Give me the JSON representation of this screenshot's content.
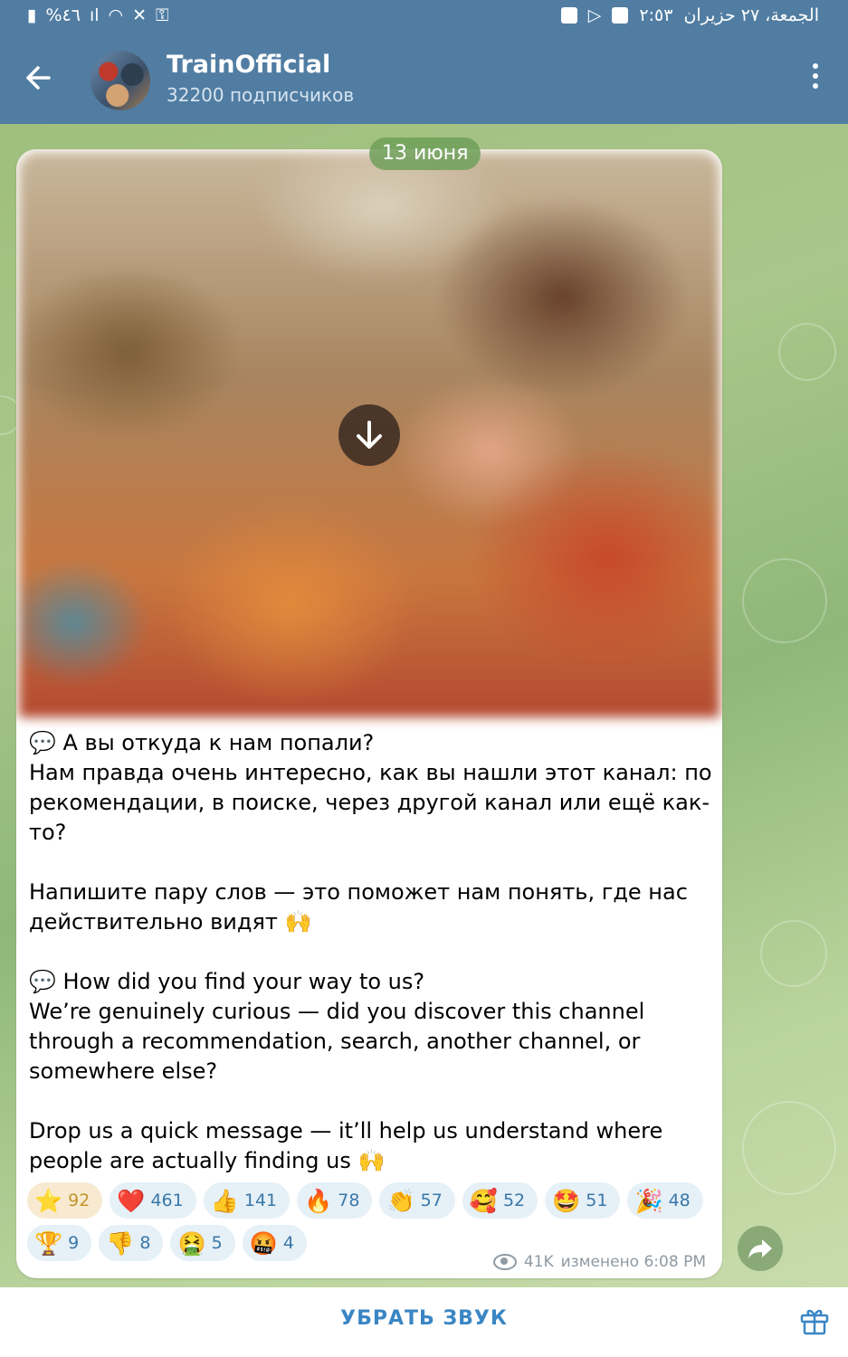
{
  "status_bar": {
    "left_text": "%٤٦",
    "right_time": "٢:٥٣",
    "right_date": "الجمعة، ٢٧ حزيران"
  },
  "header": {
    "channel_name": "TrainOfficial",
    "subscribers": "32200 подписчиков"
  },
  "date_pill": "13 июня",
  "message": {
    "text": "💬 А вы откуда к нам попали?\nНам правда очень интересно, как вы нашли этот канал: по рекомендации, в поиске, через другой канал или ещё как-то?\n\nНапишите пару слов — это поможет нам понять, где нас действительно видят 🙌\n\n💬 How did you find your way to us?\nWe’re genuinely curious — did you discover this channel through a recommendation, search, another channel, or somewhere else?\n\nDrop us a quick message — it’ll help us understand where people are actually finding us 🙌",
    "views": "41K",
    "edited": "изменено 6:08 PM"
  },
  "reactions_row1": [
    {
      "emoji": "⭐",
      "count": "92"
    },
    {
      "emoji": "❤️",
      "count": "461"
    },
    {
      "emoji": "👍",
      "count": "141"
    },
    {
      "emoji": "🔥",
      "count": "78"
    },
    {
      "emoji": "👏",
      "count": "57"
    },
    {
      "emoji": "🥰",
      "count": "52"
    },
    {
      "emoji": "🤩",
      "count": "51"
    },
    {
      "emoji": "🎉",
      "count": "48"
    }
  ],
  "reactions_row2": [
    {
      "emoji": "🏆",
      "count": "9"
    },
    {
      "emoji": "👎",
      "count": "8"
    },
    {
      "emoji": "🤮",
      "count": "5"
    },
    {
      "emoji": "🤬",
      "count": "4"
    }
  ],
  "bottom": {
    "mute_label": "УБРАТЬ ЗВУК"
  },
  "colors": {
    "header": "#517da2",
    "accent": "#3a86c4"
  }
}
